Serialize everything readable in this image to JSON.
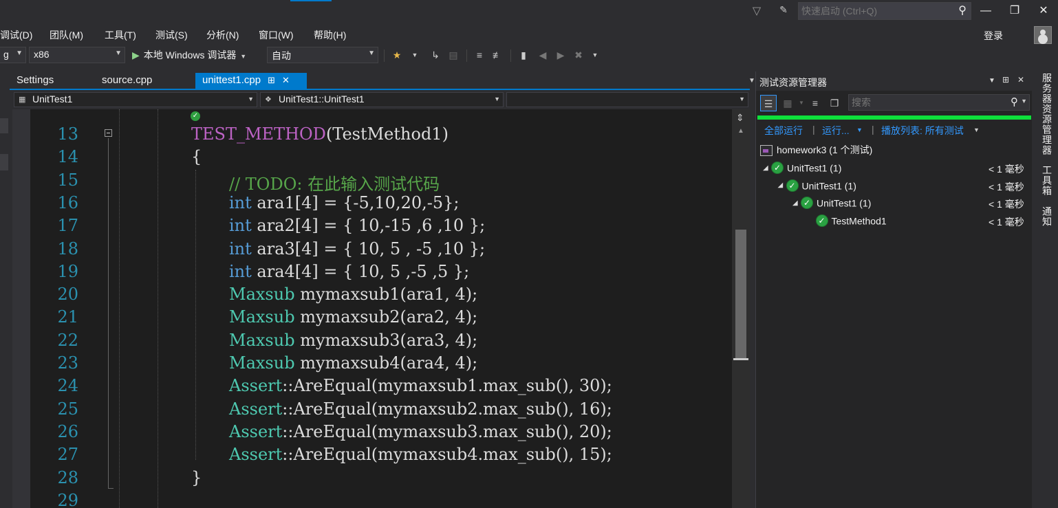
{
  "titlebar": {
    "quick_launch_placeholder": "快速启动 (Ctrl+Q)"
  },
  "menu": [
    "调试(D)",
    "团队(M)",
    "工具(T)",
    "测试(S)",
    "分析(N)",
    "窗口(W)",
    "帮助(H)"
  ],
  "account": {
    "login_label": "登录"
  },
  "toolbar": {
    "config_value": "g",
    "platform_value": "x86",
    "run_label": "本地 Windows 调试器",
    "run_mode_value": "自动"
  },
  "tabs": [
    {
      "label": "Settings",
      "active": false
    },
    {
      "label": "source.cpp",
      "active": false
    },
    {
      "label": "unittest1.cpp",
      "active": true
    }
  ],
  "navbar": {
    "scope": "UnitTest1",
    "member": "UnitTest1::UnitTest1",
    "third": ""
  },
  "editor": {
    "lines": [
      {
        "n": "13",
        "indent": 1,
        "tokens": [
          [
            "mac",
            "TEST_METHOD"
          ],
          [
            "p",
            "(TestMethod1)"
          ]
        ]
      },
      {
        "n": "14",
        "indent": 1,
        "tokens": [
          [
            "p",
            "{"
          ]
        ]
      },
      {
        "n": "15",
        "indent": 2,
        "tokens": [
          [
            "cm",
            "// TODO: 在此输入测试代码"
          ]
        ]
      },
      {
        "n": "16",
        "indent": 2,
        "tokens": [
          [
            "kw",
            "int"
          ],
          [
            "p",
            " ara1[4] = {-5,10,20,-5};"
          ]
        ]
      },
      {
        "n": "17",
        "indent": 2,
        "tokens": [
          [
            "kw",
            "int"
          ],
          [
            "p",
            " ara2[4] = { 10,-15 ,6 ,10 };"
          ]
        ]
      },
      {
        "n": "18",
        "indent": 2,
        "tokens": [
          [
            "kw",
            "int"
          ],
          [
            "p",
            " ara3[4] = { 10, 5 , -5 ,10 };"
          ]
        ]
      },
      {
        "n": "19",
        "indent": 2,
        "tokens": [
          [
            "kw",
            "int"
          ],
          [
            "p",
            " ara4[4] = { 10, 5 ,-5 ,5 };"
          ]
        ]
      },
      {
        "n": "20",
        "indent": 2,
        "tokens": [
          [
            "ty",
            "Maxsub"
          ],
          [
            "p",
            " mymaxsub1(ara1, 4);"
          ]
        ]
      },
      {
        "n": "21",
        "indent": 2,
        "tokens": [
          [
            "ty",
            "Maxsub"
          ],
          [
            "p",
            " mymaxsub2(ara2, 4);"
          ]
        ]
      },
      {
        "n": "22",
        "indent": 2,
        "tokens": [
          [
            "ty",
            "Maxsub"
          ],
          [
            "p",
            " mymaxsub3(ara3, 4);"
          ]
        ]
      },
      {
        "n": "23",
        "indent": 2,
        "tokens": [
          [
            "ty",
            "Maxsub"
          ],
          [
            "p",
            " mymaxsub4(ara4, 4);"
          ]
        ]
      },
      {
        "n": "24",
        "indent": 2,
        "tokens": [
          [
            "ty",
            "Assert"
          ],
          [
            "p",
            "::AreEqual(mymaxsub1.max_sub(), 30);"
          ]
        ]
      },
      {
        "n": "25",
        "indent": 2,
        "tokens": [
          [
            "ty",
            "Assert"
          ],
          [
            "p",
            "::AreEqual(mymaxsub2.max_sub(), 16);"
          ]
        ]
      },
      {
        "n": "26",
        "indent": 2,
        "tokens": [
          [
            "ty",
            "Assert"
          ],
          [
            "p",
            "::AreEqual(mymaxsub3.max_sub(), 20);"
          ]
        ]
      },
      {
        "n": "27",
        "indent": 2,
        "tokens": [
          [
            "ty",
            "Assert"
          ],
          [
            "p",
            "::AreEqual(mymaxsub4.max_sub(), 15);"
          ]
        ]
      },
      {
        "n": "28",
        "indent": 1,
        "tokens": [
          [
            "p",
            "}"
          ]
        ]
      },
      {
        "n": "29",
        "indent": 1,
        "tokens": [
          [
            "p",
            ""
          ]
        ]
      }
    ]
  },
  "test_explorer": {
    "title": "测试资源管理器",
    "search_placeholder": "搜索",
    "run_all": "全部运行",
    "run": "运行...",
    "playlist": "播放列表: 所有测试",
    "project": "homework3 (1 个测试)",
    "nodes": [
      {
        "level": 0,
        "label": "UnitTest1 (1)",
        "duration": "< 1 毫秒",
        "expandable": true
      },
      {
        "level": 1,
        "label": "UnitTest1 (1)",
        "duration": "< 1 毫秒",
        "expandable": true
      },
      {
        "level": 2,
        "label": "UnitTest1 (1)",
        "duration": "< 1 毫秒",
        "expandable": true
      },
      {
        "level": 3,
        "label": "TestMethod1",
        "duration": "< 1 毫秒",
        "expandable": false
      }
    ],
    "status_color": "#0ee03b"
  },
  "right_rail": [
    "服务器资源管理器",
    "工具箱",
    "通知"
  ],
  "colors": {
    "accent": "#007acc",
    "keyword": "#569cd6",
    "type": "#4ec9b0",
    "macro": "#bd63c5",
    "comment": "#57a64a",
    "line_number": "#2b91af"
  }
}
